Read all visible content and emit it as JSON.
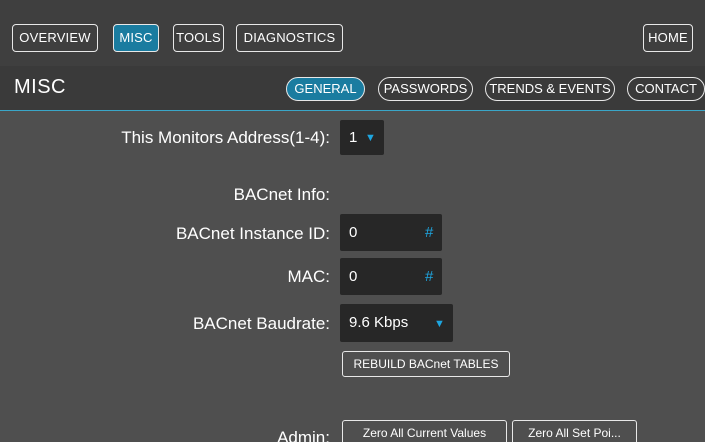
{
  "nav": {
    "overview": "OVERVIEW",
    "misc": "MISC",
    "tools": "TOOLS",
    "diagnostics": "DIAGNOSTICS",
    "home": "HOME"
  },
  "title": "MISC",
  "tabs": {
    "general": "GENERAL",
    "passwords": "PASSWORDS",
    "trends": "TRENDS & EVENTS",
    "contact": "CONTACT"
  },
  "form": {
    "monitor_address_label": "This Monitors Address(1-4):",
    "monitor_address_value": "1",
    "bacnet_info_label": "BACnet Info:",
    "instance_id_label": "BACnet Instance ID:",
    "instance_id_value": "0",
    "mac_label": "MAC:",
    "mac_value": "0",
    "baudrate_label": "BACnet Baudrate:",
    "baudrate_value": "9.6 Kbps",
    "rebuild_button": "REBUILD BACnet TABLES",
    "admin_label": "Admin:",
    "zero_current_button": "Zero All Current Values",
    "zero_setpoints_button": "Zero All Set Poi..."
  },
  "icons": {
    "caret": "▼",
    "hash": "#"
  },
  "colors": {
    "accent": "#1a7ca0",
    "icon_blue": "#1ea6e0",
    "background": "#4f4f4f"
  }
}
